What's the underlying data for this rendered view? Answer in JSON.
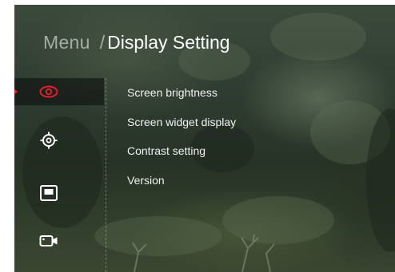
{
  "header": {
    "menu_label": "Menu",
    "separator": "/",
    "title": "Display Setting"
  },
  "sidebar": {
    "items": [
      {
        "icon": "eye-icon",
        "active": true,
        "color": "#e0202a"
      },
      {
        "icon": "crosshair-icon",
        "active": false,
        "color": "#ffffff"
      },
      {
        "icon": "screen-icon",
        "active": false,
        "color": "#ffffff"
      },
      {
        "icon": "video-camera-icon",
        "active": false,
        "color": "#ffffff"
      }
    ]
  },
  "menu": {
    "items": [
      {
        "label": "Screen brightness"
      },
      {
        "label": "Screen widget display"
      },
      {
        "label": "Contrast setting"
      },
      {
        "label": "Version"
      }
    ]
  },
  "colors": {
    "accent": "#e0202a",
    "text": "#f2f2f2",
    "muted": "#c8cdc8"
  }
}
